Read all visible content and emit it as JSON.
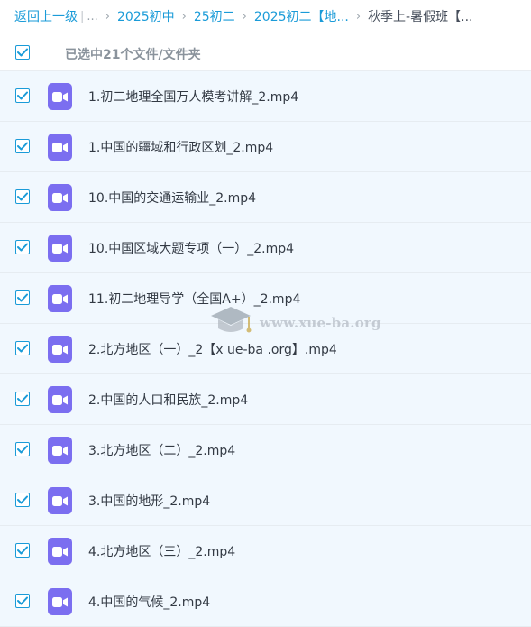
{
  "breadcrumb": {
    "back": "返回上一级",
    "pipe": "|",
    "more": "...",
    "sep": "›",
    "items": [
      "2025初中",
      "25初二",
      "2025初二【地..."
    ],
    "current": "秋季上-暑假班【..."
  },
  "selection": {
    "summary": "已选中21个文件/文件夹",
    "all_checked": true
  },
  "files": [
    {
      "name": "1.初二地理全国万人模考讲解_2.mp4",
      "checked": true
    },
    {
      "name": "1.中国的疆域和行政区划_2.mp4",
      "checked": true
    },
    {
      "name": "10.中国的交通运输业_2.mp4",
      "checked": true
    },
    {
      "name": "10.中国区域大题专项（一）_2.mp4",
      "checked": true
    },
    {
      "name": "11.初二地理导学（全国A+）_2.mp4",
      "checked": true
    },
    {
      "name": "2.北方地区（一）_2【x ue-ba .org】.mp4",
      "checked": true
    },
    {
      "name": "2.中国的人口和民族_2.mp4",
      "checked": true
    },
    {
      "name": "3.北方地区（二）_2.mp4",
      "checked": true
    },
    {
      "name": "3.中国的地形_2.mp4",
      "checked": true
    },
    {
      "name": "4.北方地区（三）_2.mp4",
      "checked": true
    },
    {
      "name": "4.中国的气候_2.mp4",
      "checked": true
    }
  ],
  "icons": {
    "checkbox": "checkmark-icon",
    "file": "video-file-icon",
    "watermark": "graduation-cap-icon"
  },
  "watermark": {
    "text": "www.xue-ba.org"
  },
  "colors": {
    "accent": "#1a9bd8",
    "row_bg": "#f1f8fe",
    "video_icon": "#7b6ef0"
  }
}
